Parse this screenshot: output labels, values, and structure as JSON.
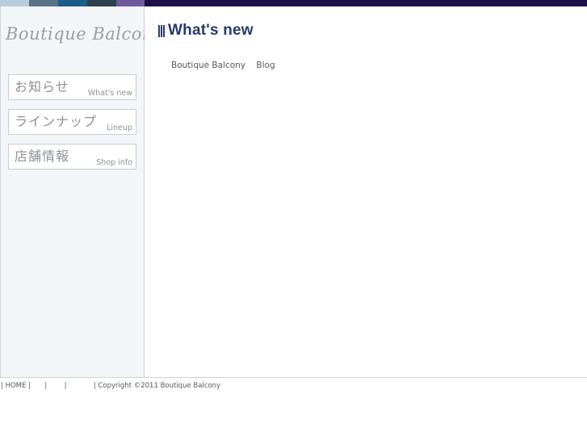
{
  "topbar": {
    "colors": [
      "#b7ccdd",
      "#587388",
      "#1d5c88",
      "#2f3f4e",
      "#6f5aa0",
      "#1f0f48"
    ]
  },
  "sidebar": {
    "logo_text": "Boutique Balcony",
    "nav": [
      {
        "jp": "お知らせ",
        "en": "What's new"
      },
      {
        "jp": "ラインナップ",
        "en": "Lineup"
      },
      {
        "jp": "店舗情報",
        "en": "Shop info"
      }
    ]
  },
  "main": {
    "title": "What's new",
    "links": [
      "Boutique Balcony",
      "Blog"
    ]
  },
  "footer": {
    "sep": "|",
    "home": "HOME",
    "copyright": "Copyright ©2011 Boutique Balcony"
  }
}
